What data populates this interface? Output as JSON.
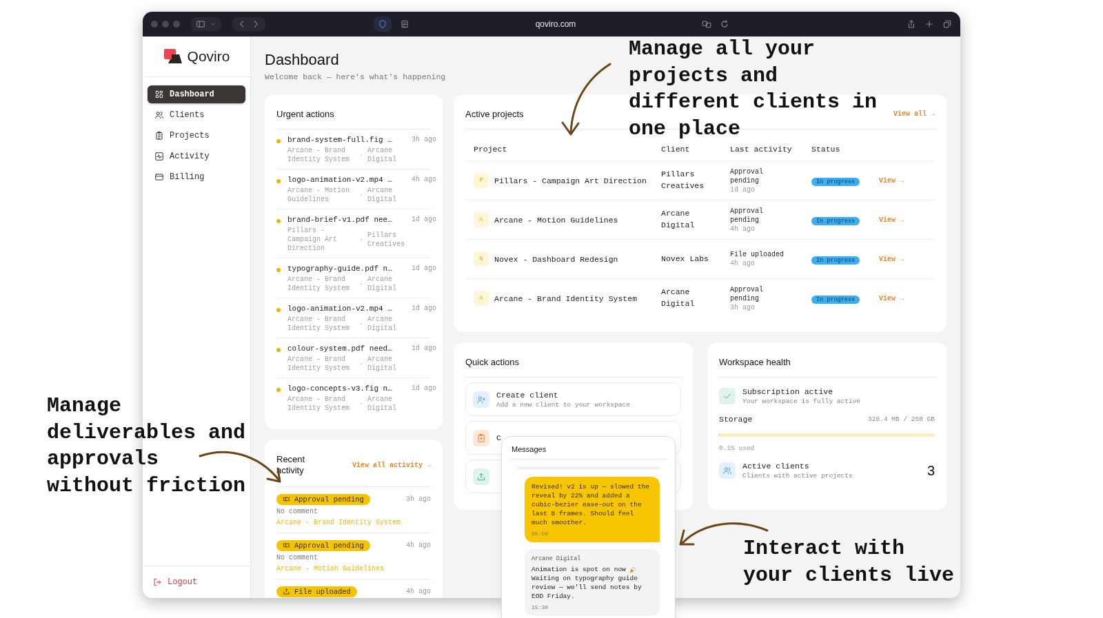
{
  "browser": {
    "url": "qoviro.com"
  },
  "sidebar": {
    "brand": "Qoviro",
    "items": [
      {
        "kind": "dashboard",
        "label": "Dashboard",
        "selected": true
      },
      {
        "kind": "clients",
        "label": "Clients",
        "selected": false
      },
      {
        "kind": "projects",
        "label": "Projects",
        "selected": false
      },
      {
        "kind": "activity",
        "label": "Activity",
        "selected": false
      },
      {
        "kind": "billing",
        "label": "Billing",
        "selected": false
      }
    ],
    "logout": "Logout"
  },
  "header": {
    "title": "Dashboard",
    "subtitle": "Welcome back — here's what's happening"
  },
  "urgent_actions": {
    "title": "Urgent actions",
    "items": [
      {
        "file": "brand-system-full.fig …",
        "project": "Arcane - Brand Identity System",
        "client": "Arcane Digital",
        "time": "3h ago"
      },
      {
        "file": "logo-animation-v2.mp4 …",
        "project": "Arcane - Motion Guidelines",
        "client": "Arcane Digital",
        "time": "4h ago"
      },
      {
        "file": "brand-brief-v1.pdf nee…",
        "project": "Pillars - Campaign Art Direction",
        "client": "Pillars Creatives",
        "time": "1d ago"
      },
      {
        "file": "typography-guide.pdf n…",
        "project": "Arcane - Brand Identity System",
        "client": "Arcane Digital",
        "time": "1d ago"
      },
      {
        "file": "logo-animation-v2.mp4 …",
        "project": "Arcane - Brand Identity System",
        "client": "Arcane Digital",
        "time": "1d ago"
      },
      {
        "file": "colour-system.pdf need…",
        "project": "Arcane - Brand Identity System",
        "client": "Arcane Digital",
        "time": "1d ago"
      },
      {
        "file": "logo-concepts-v3.fig n…",
        "project": "Arcane - Brand Identity System",
        "client": "Arcane Digital",
        "time": "1d ago"
      }
    ]
  },
  "recent_activity": {
    "title": "Recent activity",
    "link": "View all activity →",
    "items": [
      {
        "kind": "approval",
        "badge": "Approval pending",
        "time": "3h ago",
        "comment": "No comment",
        "project": "Arcane - Brand Identity System"
      },
      {
        "kind": "approval",
        "badge": "Approval pending",
        "time": "4h ago",
        "comment": "No comment",
        "project": "Arcane - Motion Guidelines"
      },
      {
        "kind": "upload",
        "badge": "File uploaded",
        "time": "4h ago"
      }
    ]
  },
  "active_projects": {
    "title": "Active projects",
    "link": "View all →",
    "columns": [
      "Project",
      "Client",
      "Last activity",
      "Status"
    ],
    "rows": [
      {
        "initial": "P",
        "project": "Pillars - Campaign Art Direction",
        "client": "Pillars Creatives",
        "activity": "Approval pending",
        "time": "1d ago",
        "status": "In progress",
        "action": "View →"
      },
      {
        "initial": "A",
        "project": "Arcane - Motion Guidelines",
        "client": "Arcane Digital",
        "activity": "Approval pending",
        "time": "4h ago",
        "status": "In progress",
        "action": "View →"
      },
      {
        "initial": "N",
        "project": "Novex - Dashboard Redesign",
        "client": "Novex Labs",
        "activity": "File uploaded",
        "time": "4h ago",
        "status": "In progress",
        "action": "View →"
      },
      {
        "initial": "A",
        "project": "Arcane - Brand Identity System",
        "client": "Arcane Digital",
        "activity": "Approval pending",
        "time": "3h ago",
        "status": "In progress",
        "action": "View →"
      }
    ]
  },
  "quick_actions": {
    "title": "Quick actions",
    "items": [
      {
        "kind": "client",
        "title": "Create client",
        "description": "Add a new client to your workspace"
      },
      {
        "kind": "project",
        "title": "C"
      },
      {
        "kind": "upload"
      }
    ]
  },
  "workspace_health": {
    "title": "Workspace health",
    "subscription": {
      "title": "Subscription active",
      "description": "Your workspace is fully active"
    },
    "storage": {
      "label": "Storage",
      "value": "328.4 MB / 250 GB",
      "level": 0.001,
      "note": "0.1% used"
    },
    "clients": {
      "title": "Active clients",
      "description": "Clients with active projects",
      "count": "3"
    }
  },
  "messages": {
    "title": "Messages",
    "items": [
      {
        "kind": "sent",
        "text": "Revised! v2 is up — slowed the reveal by 22% and added a cubic-bezier ease-out on the last 8 frames. Should feel much smoother.",
        "time": "09:50"
      },
      {
        "kind": "received",
        "sender": "Arcane Digital",
        "text": "Animation is spot on now",
        "text_2": "Waiting on typography guide review — we'll send notes by EOD Friday.",
        "time": "15:30"
      }
    ]
  },
  "annotations": [
    {
      "lines": [
        "Manage all your",
        "projects and",
        "different clients in",
        "one place"
      ]
    },
    {
      "lines": [
        "Manage",
        "deliverables and",
        "approvals",
        "without friction"
      ]
    },
    {
      "lines": [
        "Interact with",
        "your clients live"
      ]
    }
  ]
}
